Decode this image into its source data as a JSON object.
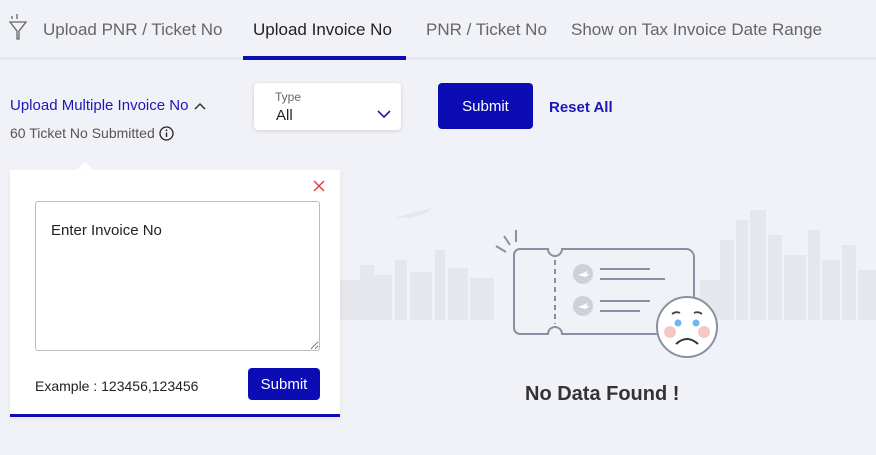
{
  "tabs": [
    {
      "label": "Upload PNR / Ticket No",
      "active": false
    },
    {
      "label": "Upload Invoice No",
      "active": true
    },
    {
      "label": "PNR / Ticket No",
      "active": false
    },
    {
      "label": "Show on Tax Invoice Date Range",
      "active": false
    }
  ],
  "upload": {
    "toggle_label": "Upload Multiple Invoice No",
    "submitted_text": "60 Ticket No Submitted"
  },
  "type_select": {
    "label": "Type",
    "value": "All"
  },
  "actions": {
    "submit_label": "Submit",
    "reset_label": "Reset All"
  },
  "popup": {
    "placeholder": "Enter Invoice No",
    "value": "",
    "example": "Example : 123456,123456",
    "submit_label": "Submit"
  },
  "empty_state": {
    "message": "No Data Found !"
  },
  "colors": {
    "accent": "#0c0cb5",
    "link": "#1d17b8",
    "background": "#f1f2f7",
    "close": "#e53935"
  },
  "icons": [
    "filter-icon",
    "chevron-up-icon",
    "info-icon",
    "chevron-down-icon",
    "close-icon",
    "plane-icon",
    "sad-face-icon"
  ]
}
